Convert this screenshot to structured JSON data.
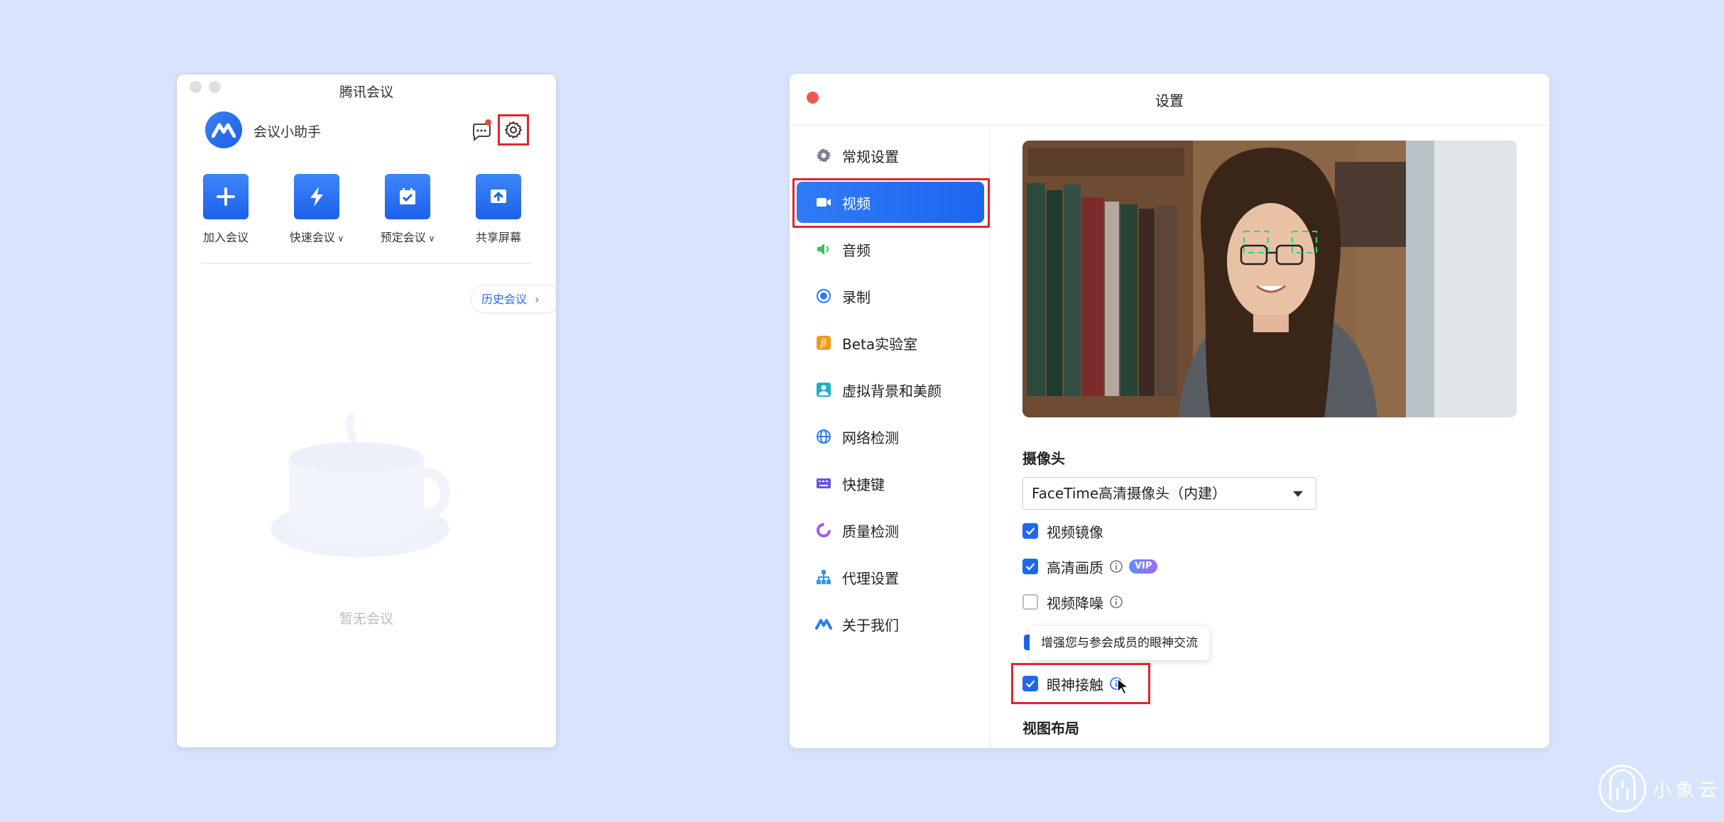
{
  "left_window": {
    "title": "腾讯会议",
    "assistant_name": "会议小助手",
    "actions": [
      {
        "label": "加入会议",
        "icon": "plus-icon"
      },
      {
        "label": "快速会议",
        "icon": "lightning-icon",
        "dropdown": true
      },
      {
        "label": "预定会议",
        "icon": "calendar-check-icon",
        "dropdown": true
      },
      {
        "label": "共享屏幕",
        "icon": "share-screen-icon"
      }
    ],
    "history_button": "历史会议",
    "empty_text": "暂无会议",
    "settings_highlighted": true
  },
  "settings_window": {
    "title": "设置",
    "nav": [
      {
        "label": "常规设置",
        "icon": "gear-icon",
        "active": false
      },
      {
        "label": "视频",
        "icon": "video-camera-icon",
        "active": true
      },
      {
        "label": "音频",
        "icon": "speaker-icon",
        "active": false
      },
      {
        "label": "录制",
        "icon": "record-icon",
        "active": false
      },
      {
        "label": "Beta实验室",
        "icon": "beta-icon",
        "active": false
      },
      {
        "label": "虚拟背景和美颜",
        "icon": "portrait-icon",
        "active": false
      },
      {
        "label": "网络检测",
        "icon": "globe-icon",
        "active": false
      },
      {
        "label": "快捷键",
        "icon": "keyboard-icon",
        "active": false
      },
      {
        "label": "质量检测",
        "icon": "quality-icon",
        "active": false
      },
      {
        "label": "代理设置",
        "icon": "proxy-icon",
        "active": false
      },
      {
        "label": "关于我们",
        "icon": "about-logo-icon",
        "active": false
      }
    ],
    "camera_section": "摄像头",
    "camera_selected": "FaceTime高清摄像头（内建）",
    "options": [
      {
        "label": "视频镜像",
        "checked": true,
        "info": false,
        "vip": false
      },
      {
        "label": "高清画质",
        "checked": true,
        "info": true,
        "vip": true
      },
      {
        "label": "视频降噪",
        "checked": false,
        "info": true,
        "vip": false
      },
      {
        "label": "眼神接触",
        "checked": true,
        "info": true,
        "vip": false
      }
    ],
    "vip_badge": "VIP",
    "tooltip": "增强您与参会成员的眼神交流",
    "layout_section": "视图布局"
  },
  "brand": {
    "name": "小象云"
  },
  "colors": {
    "background": "#d7e4fc",
    "accent": "#2066ee",
    "highlight_box": "#e0262d"
  }
}
